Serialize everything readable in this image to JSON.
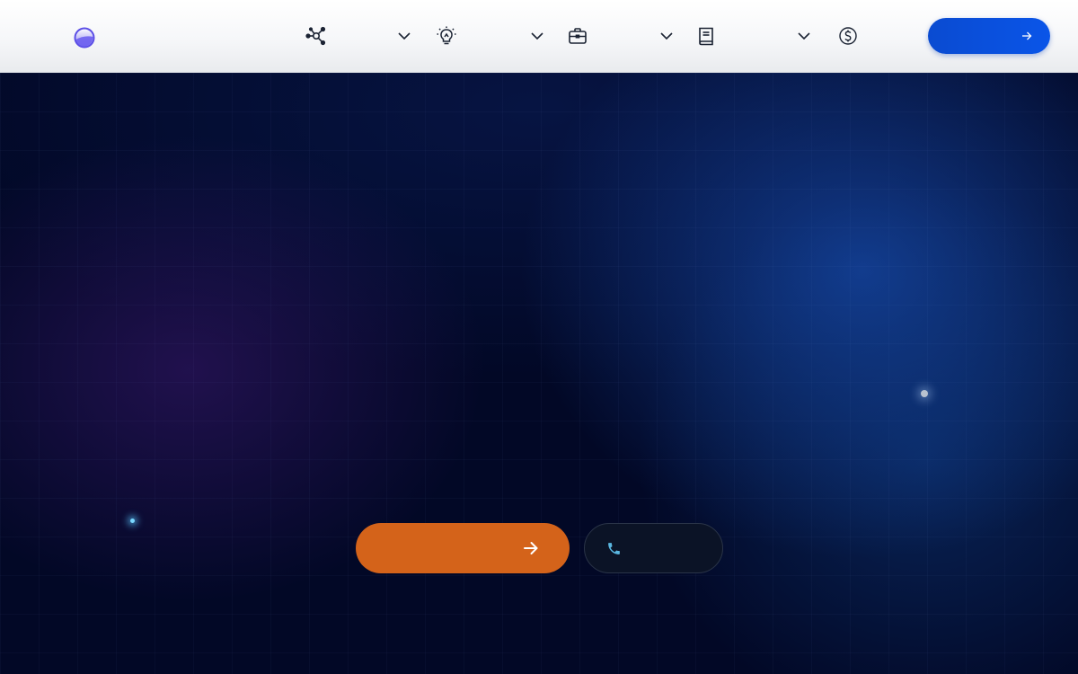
{
  "nav": {
    "items": [
      {
        "icon": "network-icon",
        "label": ""
      },
      {
        "icon": "lightbulb-icon",
        "label": ""
      },
      {
        "icon": "briefcase-icon",
        "label": ""
      },
      {
        "icon": "book-icon",
        "label": ""
      },
      {
        "icon": "dollar-icon",
        "label": ""
      }
    ],
    "cta_label": ""
  },
  "hero": {
    "heading": "",
    "subheading": "",
    "primary_button_label": "",
    "secondary_button_label": ""
  },
  "colors": {
    "header_background": "#ffffff",
    "nav_icon": "#1b2333",
    "logo_accent": "#5b4ee6",
    "cta_blue": "#0a4bd1",
    "hero_background": "#020826",
    "primary_orange": "#d4631a",
    "secondary_dark": "#0b1326",
    "phone_icon_cyan": "#5ab6e0"
  }
}
